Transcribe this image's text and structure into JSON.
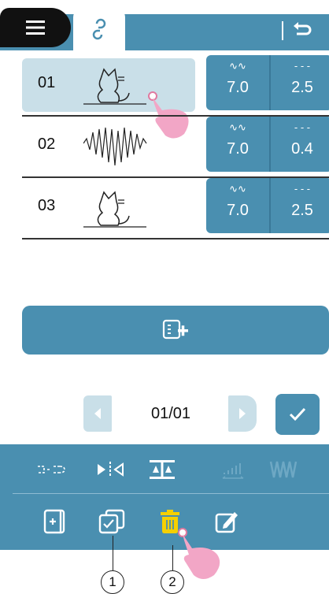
{
  "top_bar": {
    "menu_icon": "hamburger-menu-icon",
    "tab_icon": "pattern-link-icon",
    "back_icon": "return-arrow-icon"
  },
  "patterns": [
    {
      "number": "01",
      "image": "cat-outline",
      "icon_left": "width-icon",
      "value_left": "7.0",
      "icon_right": "length-icon",
      "value_right": "2.5",
      "selected": true
    },
    {
      "number": "02",
      "image": "heart-zigzag",
      "icon_left": "width-icon",
      "value_left": "7.0",
      "icon_right": "length-icon",
      "value_right": "0.4",
      "selected": false
    },
    {
      "number": "03",
      "image": "cat-outline",
      "icon_left": "width-icon",
      "value_left": "7.0",
      "icon_right": "length-icon",
      "value_right": "2.5",
      "selected": false
    }
  ],
  "add_button_icon": "add-pattern-icon",
  "pager": {
    "text": "01/01"
  },
  "tools_row1": [
    "join-icon",
    "mirror-icon",
    "balance-icon",
    "density-icon",
    "repeat-icon"
  ],
  "tools_row2": [
    "insert-icon",
    "duplicate-icon",
    "delete-icon",
    "edit-icon"
  ],
  "callouts": [
    "1",
    "2"
  ],
  "colors": {
    "accent": "#4a8fb0",
    "selected": "#c9dfe8",
    "delete": "#f5d000",
    "pointer": "#f0a0c0"
  }
}
